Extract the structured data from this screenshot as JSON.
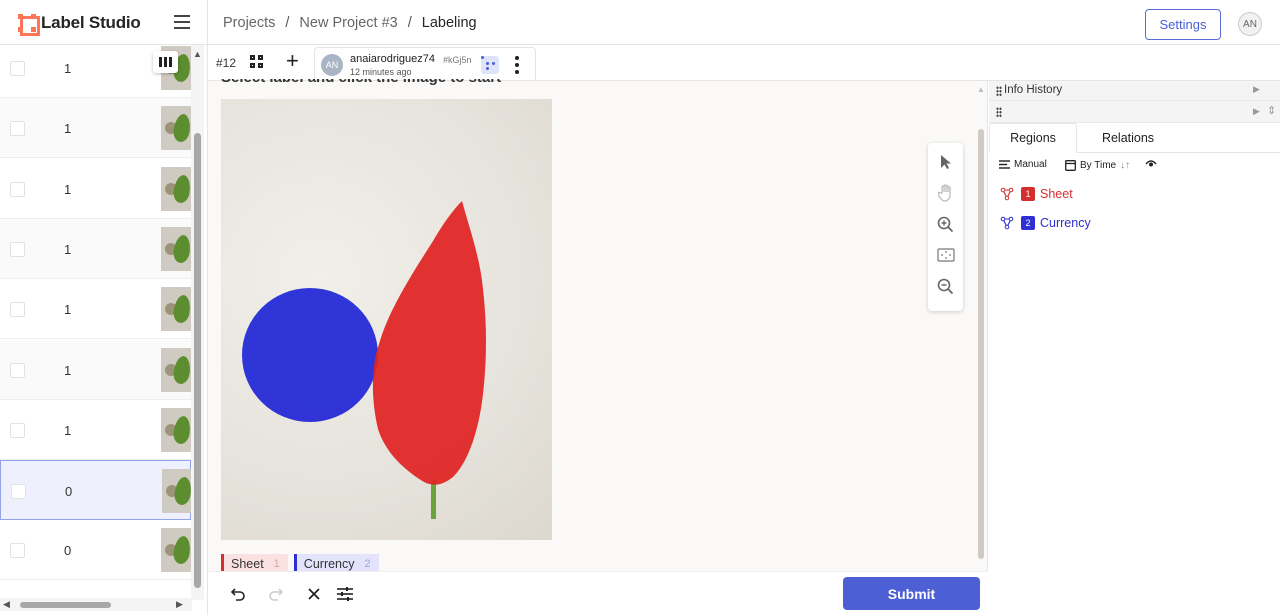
{
  "header": {
    "app_name": "Label Studio",
    "breadcrumb": [
      "Projects",
      "New Project #3",
      "Labeling"
    ],
    "breadcrumb_sep": "/",
    "settings_label": "Settings",
    "user_initials": "AN"
  },
  "task_list": {
    "rows": [
      {
        "value": "1"
      },
      {
        "value": "1"
      },
      {
        "value": "1"
      },
      {
        "value": "1"
      },
      {
        "value": "1"
      },
      {
        "value": "1"
      },
      {
        "value": "1"
      },
      {
        "value": "0"
      },
      {
        "value": "0"
      }
    ],
    "selected_index": 7
  },
  "toolbar": {
    "task_id": "#12",
    "annotation": {
      "user_initials": "AN",
      "user": "anaiarodriguez74",
      "hash": "#kGj5n",
      "time": "12 minutes ago"
    }
  },
  "main": {
    "instruction": "Select label and click the image to start",
    "submit_label": "Submit"
  },
  "labels": [
    {
      "name": "Sheet",
      "hotkey": "1",
      "color": "#d32f2f"
    },
    {
      "name": "Currency",
      "hotkey": "2",
      "color": "#2f2fd3"
    }
  ],
  "sidebar": {
    "info_history_label": "Info History",
    "tabs": [
      "Regions",
      "Relations"
    ],
    "order_manual": "Manual",
    "order_time": "By Time",
    "regions": [
      {
        "index": "1",
        "name": "Sheet",
        "color": "#d32f2f"
      },
      {
        "index": "2",
        "name": "Currency",
        "color": "#2f2fd3"
      }
    ]
  },
  "icons": [
    "hamburger-icon",
    "columns-icon",
    "grid-icon",
    "plus-icon",
    "kebab-icon",
    "pointer-icon",
    "hand-icon",
    "zoom-in-icon",
    "zoom-fit-icon",
    "zoom-out-icon",
    "undo-icon",
    "redo-icon",
    "close-icon",
    "settings-sliders-icon",
    "eye-icon"
  ]
}
